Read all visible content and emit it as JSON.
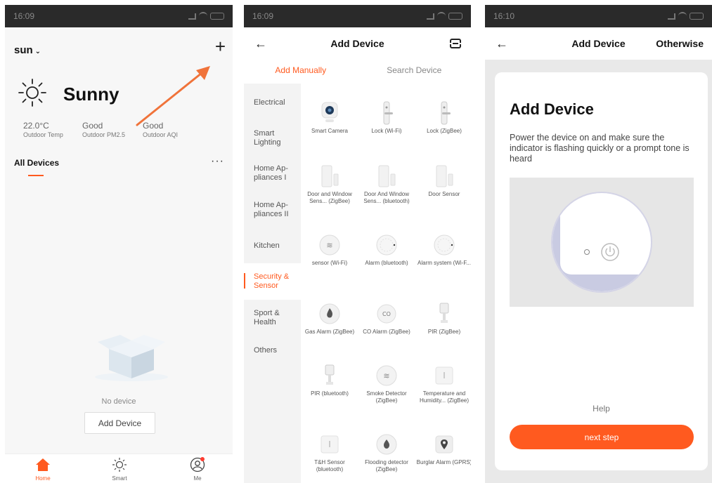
{
  "panel1": {
    "status_time": "16:09",
    "home_name": "sun",
    "weather": "Sunny",
    "metrics": [
      {
        "value": "22.0°C",
        "label": "Outdoor Temp"
      },
      {
        "value": "Good",
        "label": "Outdoor PM2.5"
      },
      {
        "value": "Good",
        "label": "Outdoor AQI"
      }
    ],
    "devices_tab": "All Devices",
    "more": "···",
    "empty_text": "No device",
    "add_device_button": "Add Device",
    "tabbar": [
      {
        "label": "Home",
        "icon": "home-icon",
        "active": true
      },
      {
        "label": "Smart",
        "icon": "sun-icon",
        "active": false
      },
      {
        "label": "Me",
        "icon": "user-icon",
        "active": false
      }
    ],
    "accent": "#ff5a1f"
  },
  "panel2": {
    "status_time": "16:09",
    "title": "Add Device",
    "tabs": [
      "Add Manually",
      "Search Device"
    ],
    "categories": [
      "Electrical",
      "Smart Lighting",
      "Home Ap-pliances I",
      "Home Ap-pliances II",
      "Kitchen",
      "Security & Sensor",
      "Sport & Health",
      "Others"
    ],
    "active_category": "Security & Sensor",
    "devices": [
      {
        "name": "Smart Camera",
        "icon": "camera-icon"
      },
      {
        "name": "Lock (Wi-Fi)",
        "icon": "lock-icon"
      },
      {
        "name": "Lock (ZigBee)",
        "icon": "lock-icon"
      },
      {
        "name": "Door and Window Sens... (ZigBee)",
        "icon": "door-sensor-icon"
      },
      {
        "name": "Door And Window Sens... (bluetooth)",
        "icon": "door-sensor-icon"
      },
      {
        "name": "Door Sensor",
        "icon": "door-sensor-icon"
      },
      {
        "name": "sensor (Wi-Fi)",
        "icon": "sensor-icon"
      },
      {
        "name": "Alarm (bluetooth)",
        "icon": "alarm-icon"
      },
      {
        "name": "Alarm system (Wi-F...",
        "icon": "alarm-icon"
      },
      {
        "name": "Gas Alarm (ZigBee)",
        "icon": "gas-alarm-icon"
      },
      {
        "name": "CO Alarm (ZigBee)",
        "icon": "co-alarm-icon"
      },
      {
        "name": "PIR (ZigBee)",
        "icon": "pir-icon"
      },
      {
        "name": "PIR (bluetooth)",
        "icon": "pir-icon"
      },
      {
        "name": "Smoke Detector (ZigBee)",
        "icon": "smoke-detector-icon"
      },
      {
        "name": "Temperature and Humidity... (ZigBee)",
        "icon": "thermometer-icon"
      },
      {
        "name": "T&H Sensor (bluetooth)",
        "icon": "thermometer-icon"
      },
      {
        "name": "Flooding detector (ZigBee)",
        "icon": "water-drop-icon"
      },
      {
        "name": "Burglar Alarm (GPRS)",
        "icon": "location-pin-icon"
      }
    ]
  },
  "panel3": {
    "status_time": "16:10",
    "title": "Add Device",
    "right_action": "Otherwise",
    "card_title": "Add Device",
    "card_desc": "Power the device on and make sure the indicator is flashing quickly or a prompt tone is heard",
    "help": "Help",
    "next_button": "next step"
  }
}
